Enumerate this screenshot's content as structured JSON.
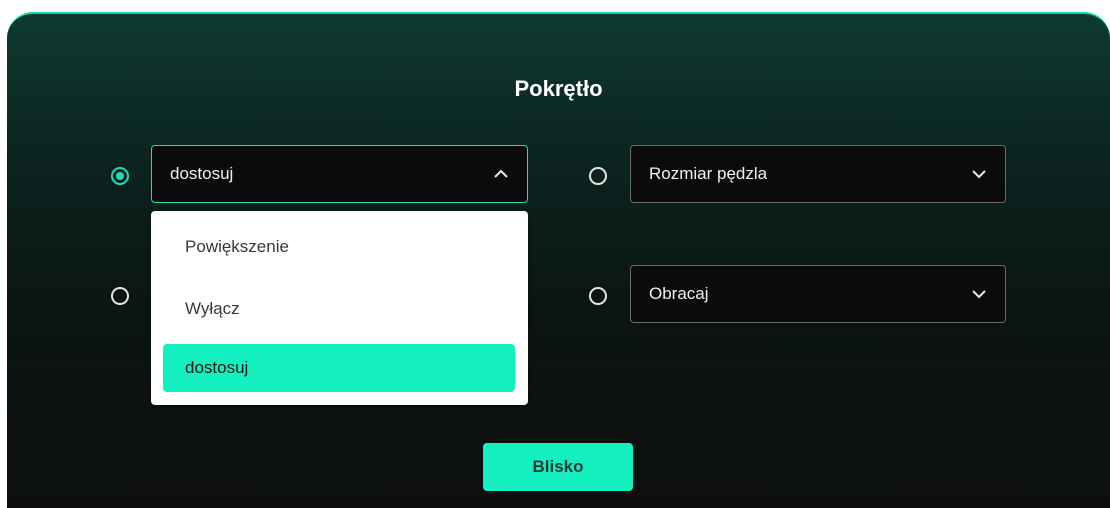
{
  "dialog": {
    "title": "Pokrętło",
    "close_label": "Blisko",
    "accent_color": "#15f0c0"
  },
  "options": [
    {
      "selected_value": "dostosuj",
      "checked": true,
      "expanded": true,
      "chevron": "chevron-up-icon"
    },
    {
      "selected_value": "Rozmiar pędzla",
      "checked": false,
      "expanded": false,
      "chevron": "chevron-down-icon"
    },
    {
      "selected_value": "",
      "checked": false,
      "expanded": false,
      "chevron": "chevron-down-icon"
    },
    {
      "selected_value": "Obracaj",
      "checked": false,
      "expanded": false,
      "chevron": "chevron-down-icon"
    }
  ],
  "dropdown_menu": {
    "items": [
      "Powiększenie",
      "Wyłącz",
      "dostosuj"
    ],
    "selected": "dostosuj"
  }
}
